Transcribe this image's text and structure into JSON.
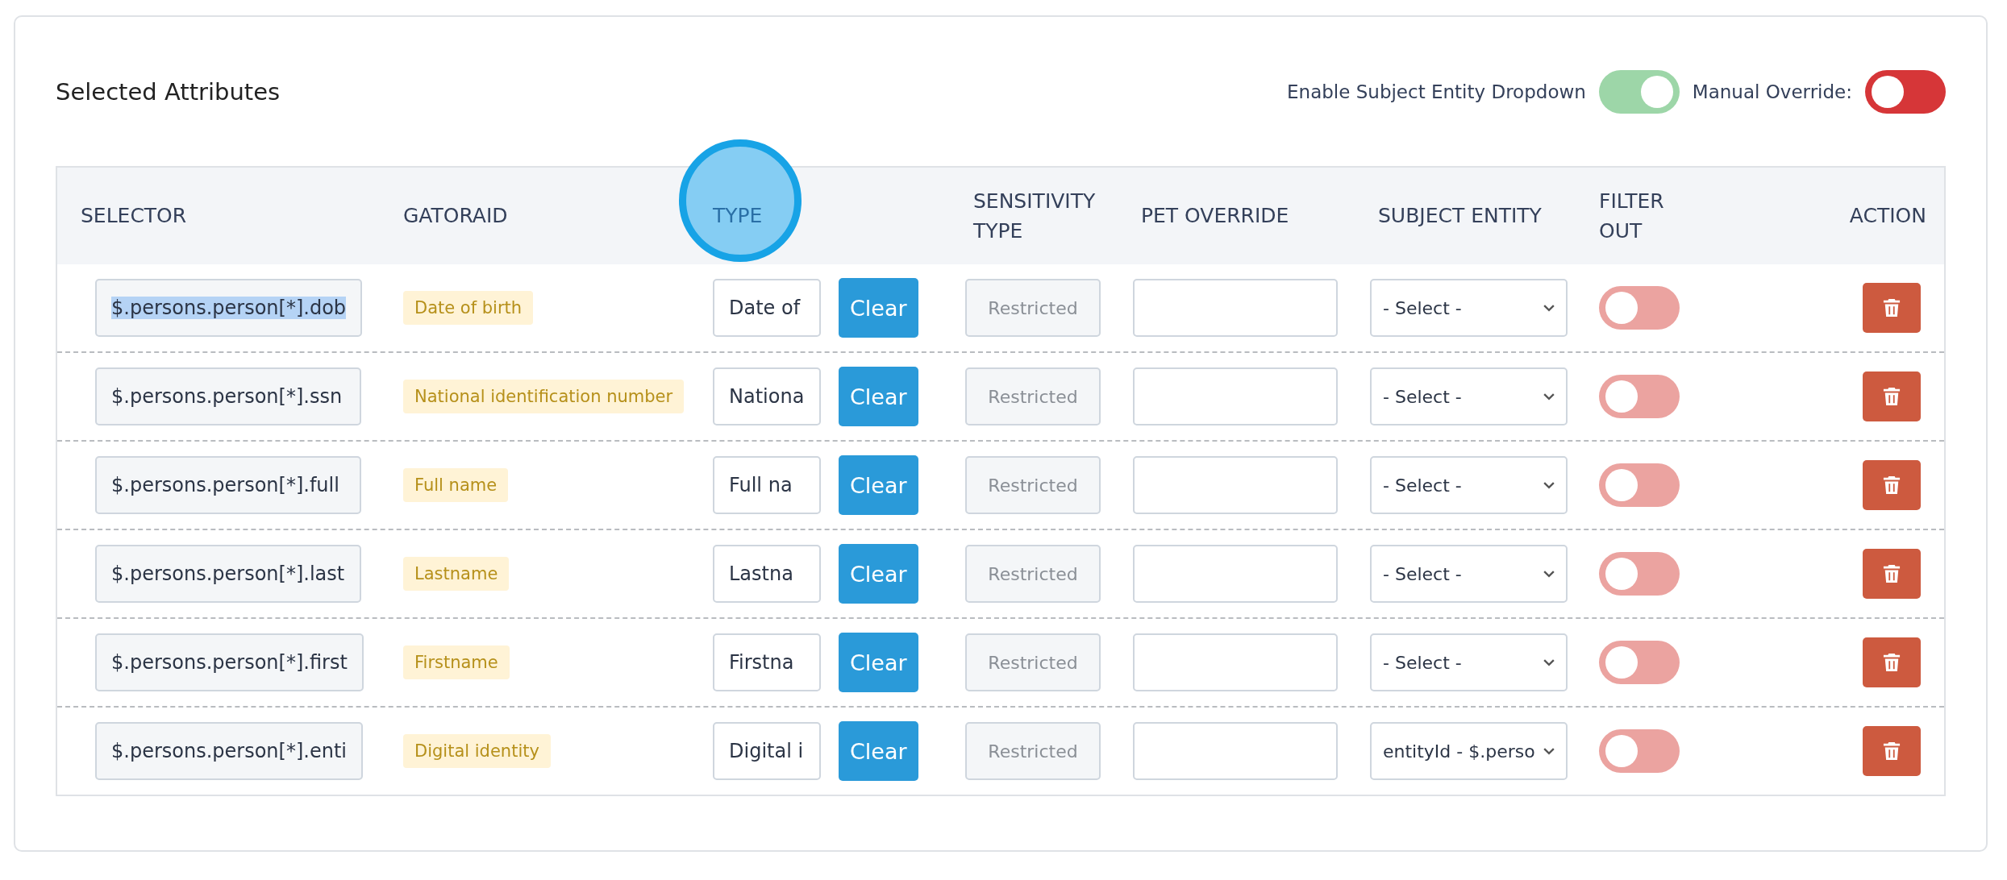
{
  "title": "Selected Attributes",
  "switches": [
    {
      "label": "Enable Subject Entity Dropdown",
      "on": true,
      "color": "#9dd6a8"
    },
    {
      "label": "Manual Override:",
      "on": false,
      "color": "#d63638"
    }
  ],
  "table": {
    "columns": [
      {
        "label": "SELECTOR",
        "highlighted": false
      },
      {
        "label": "GATORAID",
        "highlighted": false
      },
      {
        "label": "TYPE",
        "highlighted": true
      },
      {
        "label": "SENSITIVITY TYPE",
        "highlighted": false
      },
      {
        "label": "PET OVERRIDE",
        "highlighted": false
      },
      {
        "label": "SUBJECT ENTITY",
        "highlighted": false
      },
      {
        "label": "FILTER OUT",
        "highlighted": false
      },
      {
        "label": "ACTION",
        "highlighted": false
      }
    ],
    "rows": [
      {
        "selector": "$.persons.person[*].dob",
        "text_selected": true,
        "gatoraid": "Date of birth",
        "type": "Date of",
        "clear": "Clear",
        "sensitivity_placeholder": "Restricted",
        "subject_entity": "- Select -",
        "filter_out": false
      },
      {
        "selector": "$.persons.person[*].ssn",
        "text_selected": false,
        "gatoraid": "National identification number",
        "type": "Nationa",
        "clear": "Clear",
        "sensitivity_placeholder": "Restricted",
        "subject_entity": "- Select -",
        "filter_out": false
      },
      {
        "selector": "$.persons.person[*].full",
        "text_selected": false,
        "gatoraid": "Full name",
        "type": "Full na",
        "clear": "Clear",
        "sensitivity_placeholder": "Restricted",
        "subject_entity": "- Select -",
        "filter_out": false
      },
      {
        "selector": "$.persons.person[*].last",
        "text_selected": false,
        "gatoraid": "Lastname",
        "type": "Lastna",
        "clear": "Clear",
        "sensitivity_placeholder": "Restricted",
        "subject_entity": "- Select -",
        "filter_out": false
      },
      {
        "selector": "$.persons.person[*].first",
        "text_selected": false,
        "gatoraid": "Firstname",
        "type": "Firstna",
        "clear": "Clear",
        "sensitivity_placeholder": "Restricted",
        "subject_entity": "- Select -",
        "filter_out": false
      },
      {
        "selector": "$.persons.person[*].enti",
        "text_selected": false,
        "gatoraid": "Digital identity",
        "type": "Digital i",
        "clear": "Clear",
        "sensitivity_placeholder": "Restricted",
        "subject_entity": "entityId - $.perso",
        "filter_out": false
      }
    ]
  }
}
